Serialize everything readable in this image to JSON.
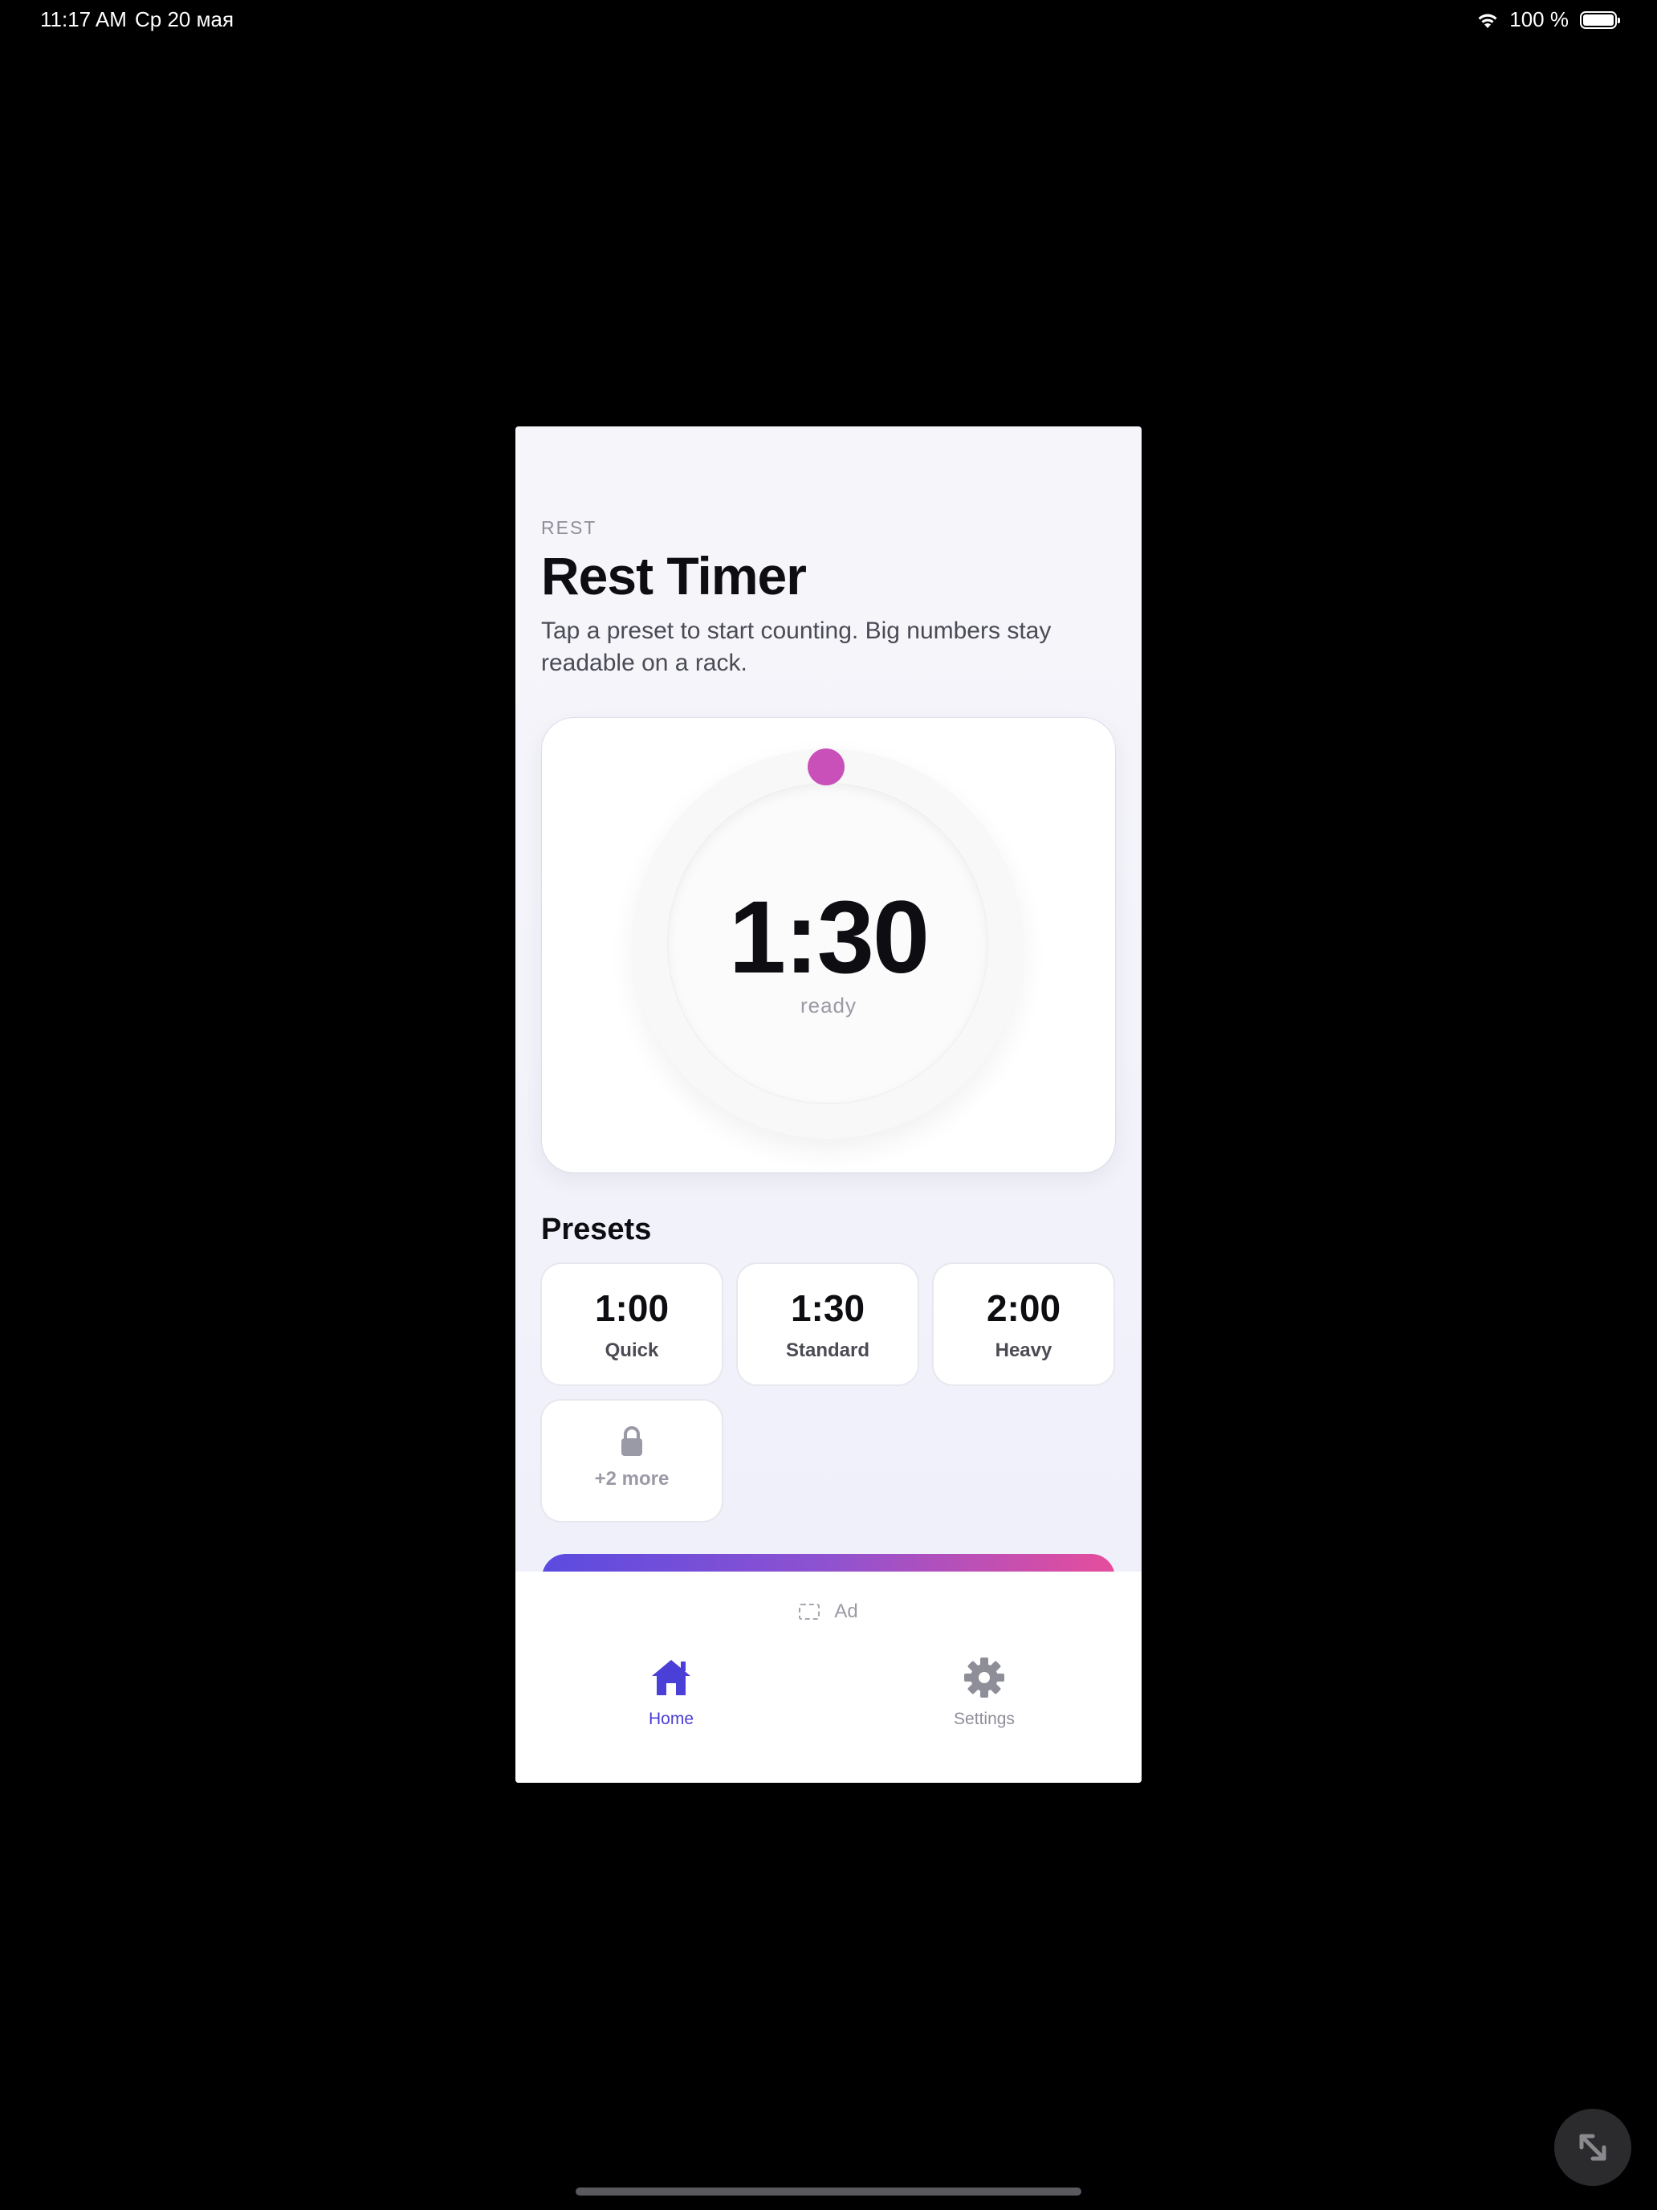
{
  "status_bar": {
    "time": "11:17 AM",
    "date": "Ср 20 мая",
    "battery": "100 %",
    "icons": [
      "wifi-icon",
      "battery-icon"
    ]
  },
  "header": {
    "eyebrow": "REST",
    "title": "Rest Timer",
    "subtitle": "Tap a preset to start counting. Big numbers stay readable on a rack."
  },
  "timer": {
    "value": "1:30",
    "status": "ready",
    "accent_color": "#c950b8"
  },
  "presets": {
    "heading": "Presets",
    "items": [
      {
        "time": "1:00",
        "label": "Quick"
      },
      {
        "time": "1:30",
        "label": "Standard"
      },
      {
        "time": "2:00",
        "label": "Heavy"
      }
    ],
    "locked": {
      "label": "+2 more",
      "icon": "lock-icon"
    }
  },
  "ad": {
    "label": "Ad",
    "icon": "ad-placeholder-icon"
  },
  "nav": {
    "active_color": "#4a3fd6",
    "items": [
      {
        "label": "Home",
        "icon": "home-icon",
        "active": true
      },
      {
        "label": "Settings",
        "icon": "gear-icon",
        "active": false
      }
    ]
  },
  "colors": {
    "gradient_start": "#5b4be0",
    "gradient_end": "#e64d9c"
  }
}
